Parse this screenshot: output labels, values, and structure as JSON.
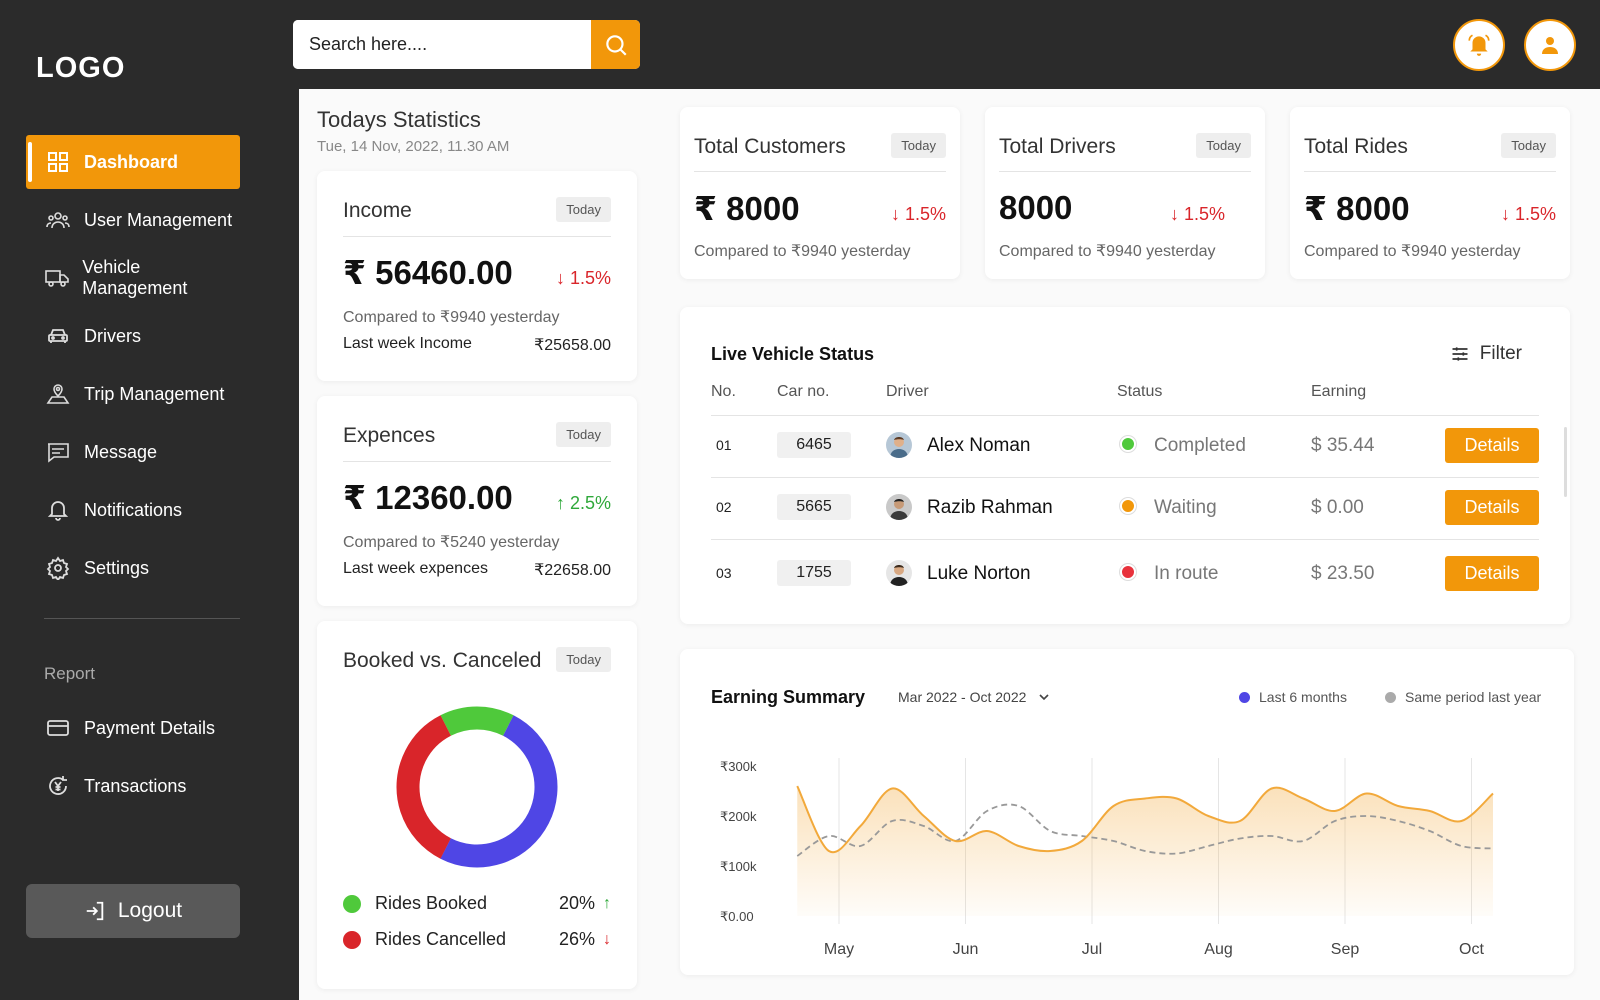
{
  "app": {
    "logo": "LOGO"
  },
  "sidebar": {
    "items": [
      {
        "label": "Dashboard",
        "icon": "dashboard-icon",
        "active": true
      },
      {
        "label": "User Management",
        "icon": "users-icon"
      },
      {
        "label": "Vehicle Management",
        "icon": "truck-icon"
      },
      {
        "label": "Drivers",
        "icon": "car-icon"
      },
      {
        "label": "Trip Management",
        "icon": "map-pin-icon"
      },
      {
        "label": "Message",
        "icon": "message-icon"
      },
      {
        "label": "Notifications",
        "icon": "bell-icon"
      },
      {
        "label": "Settings",
        "icon": "gear-icon"
      }
    ],
    "report_label": "Report",
    "report_items": [
      {
        "label": "Payment Details",
        "icon": "card-icon"
      },
      {
        "label": "Transactions",
        "icon": "transactions-icon"
      }
    ],
    "logout_label": "Logout"
  },
  "search": {
    "placeholder": "Search here...."
  },
  "stats": {
    "title": "Todays Statistics",
    "datetime": "Tue, 14 Nov, 2022, 11.30 AM"
  },
  "income": {
    "title": "Income",
    "badge": "Today",
    "value": "₹ 56460.00",
    "change": "1.5%",
    "direction": "down",
    "compare": "Compared to ₹9940 yesterday",
    "last_week_label": "Last week Income",
    "last_week_value": "₹25658.00"
  },
  "expenses": {
    "title": "Expences",
    "badge": "Today",
    "value": "₹ 12360.00",
    "change": "2.5%",
    "direction": "up",
    "compare": "Compared to ₹5240 yesterday",
    "last_week_label": "Last week expences",
    "last_week_value": "₹22658.00"
  },
  "booked": {
    "title": "Booked vs. Canceled",
    "badge": "Today",
    "legend": [
      {
        "label": "Rides Booked",
        "value": "20%",
        "direction": "up",
        "color": "#4fc93b"
      },
      {
        "label": "Rides Cancelled",
        "value": "26%",
        "direction": "down",
        "color": "#d9252a"
      }
    ],
    "donut_segments": [
      {
        "name": "booked",
        "fraction": 0.15,
        "color": "#4fc93b"
      },
      {
        "name": "other",
        "fraction": 0.5,
        "color": "#4f46e5"
      },
      {
        "name": "cancelled",
        "fraction": 0.35,
        "color": "#d9252a"
      }
    ]
  },
  "kpis": [
    {
      "title": "Total Customers",
      "badge": "Today",
      "value": "₹ 8000",
      "change": "1.5%",
      "compare": "Compared to ₹9940 yesterday"
    },
    {
      "title": "Total Drivers",
      "badge": "Today",
      "value": "8000",
      "change": "1.5%",
      "compare": "Compared to ₹9940 yesterday"
    },
    {
      "title": "Total Rides",
      "badge": "Today",
      "value": "₹ 8000",
      "change": "1.5%",
      "compare": "Compared to ₹9940 yesterday"
    }
  ],
  "vehicles": {
    "title": "Live Vehicle Status",
    "filter_label": "Filter",
    "columns": [
      "No.",
      "Car no.",
      "Driver",
      "Status",
      "Earning"
    ],
    "details_label": "Details",
    "rows": [
      {
        "no": "01",
        "car": "6465",
        "driver": "Alex Noman",
        "status": "Completed",
        "status_color": "#4fc93b",
        "earning": "$ 35.44"
      },
      {
        "no": "02",
        "car": "5665",
        "driver": "Razib Rahman",
        "status": "Waiting",
        "status_color": "#f2970a",
        "earning": "$ 0.00"
      },
      {
        "no": "03",
        "car": "1755",
        "driver": "Luke Norton",
        "status": "In route",
        "status_color": "#e8323c",
        "earning": "$ 23.50"
      }
    ]
  },
  "earning": {
    "title": "Earning Summary",
    "range": "Mar 2022 - Oct 2022",
    "legend": [
      {
        "label": "Last 6 months",
        "color": "#4f46e5"
      },
      {
        "label": "Same period last year",
        "color": "#aaaaaa"
      }
    ]
  },
  "chart_data": {
    "type": "area",
    "title": "Earning Summary",
    "ylabels": [
      "₹300k",
      "₹200k",
      "₹100k",
      "₹0.00"
    ],
    "ylim": [
      0,
      300000
    ],
    "categories": [
      "May",
      "Jun",
      "Jul",
      "Aug",
      "Sep",
      "Oct"
    ],
    "x": [
      0,
      0.25,
      0.5,
      0.75,
      1,
      1.25,
      1.5,
      1.75,
      2,
      2.25,
      2.5,
      2.75,
      3,
      3.25,
      3.5,
      3.75,
      4,
      4.25,
      4.5,
      4.75,
      5,
      5.25,
      5.5
    ],
    "series": [
      {
        "name": "Last 6 months",
        "color": "#f2a93b",
        "values": [
          260000,
          130000,
          180000,
          255000,
          200000,
          150000,
          170000,
          140000,
          130000,
          150000,
          220000,
          235000,
          235000,
          200000,
          190000,
          255000,
          235000,
          210000,
          245000,
          220000,
          210000,
          190000,
          245000
        ]
      },
      {
        "name": "Same period last year",
        "color": "#999999",
        "values": [
          120000,
          160000,
          140000,
          190000,
          180000,
          150000,
          210000,
          220000,
          170000,
          160000,
          150000,
          130000,
          125000,
          140000,
          155000,
          160000,
          150000,
          190000,
          200000,
          190000,
          170000,
          140000,
          135000
        ]
      }
    ],
    "grid": "vertical"
  }
}
